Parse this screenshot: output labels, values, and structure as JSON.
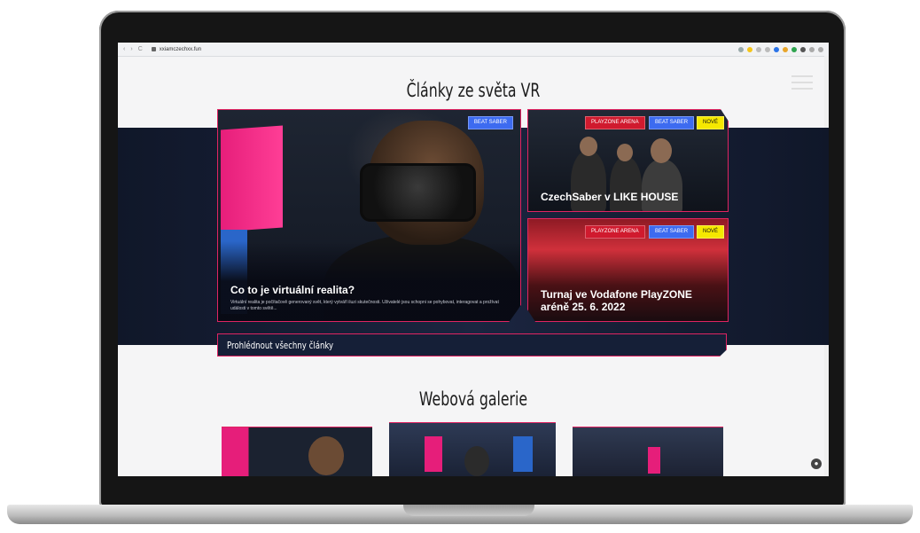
{
  "browser": {
    "nav": {
      "back": "‹",
      "forward": "›",
      "reload": "C"
    },
    "url": "xxiamczechxx.fun"
  },
  "sections": {
    "articles_title": "Články ze světa VR",
    "gallery_title": "Webová galerie"
  },
  "articles": {
    "main": {
      "tag": "BEAT SABER",
      "title": "Co to je virtuální realita?",
      "excerpt": "Virtuální realita je počítačově generovaný svět, který vytváří iluzi skutečnosti. Uživatelé jsou schopni se pohybovat, interagovat a prožívat události v tomto světě..."
    },
    "top": {
      "tags": [
        "PLAYZONE ARENA",
        "BEAT SABER",
        "NOVÉ"
      ],
      "title": "CzechSaber v LIKE HOUSE"
    },
    "bottom": {
      "tags": [
        "PLAYZONE ARENA",
        "BEAT SABER",
        "NOVÉ"
      ],
      "title": "Turnaj ve Vodafone PlayZONE aréně 25. 6. 2022"
    },
    "view_all": "Prohlédnout všechny články"
  },
  "colors": {
    "accent_pink": "#e02462",
    "accent_blue": "#3d6bf0",
    "tag_red": "#d01a2e",
    "tag_yellow": "#f5e800",
    "band": "#141d33"
  },
  "icons": {
    "chat": "chat-icon",
    "menu": "hamburger-menu-icon",
    "lock": "lock-icon"
  }
}
